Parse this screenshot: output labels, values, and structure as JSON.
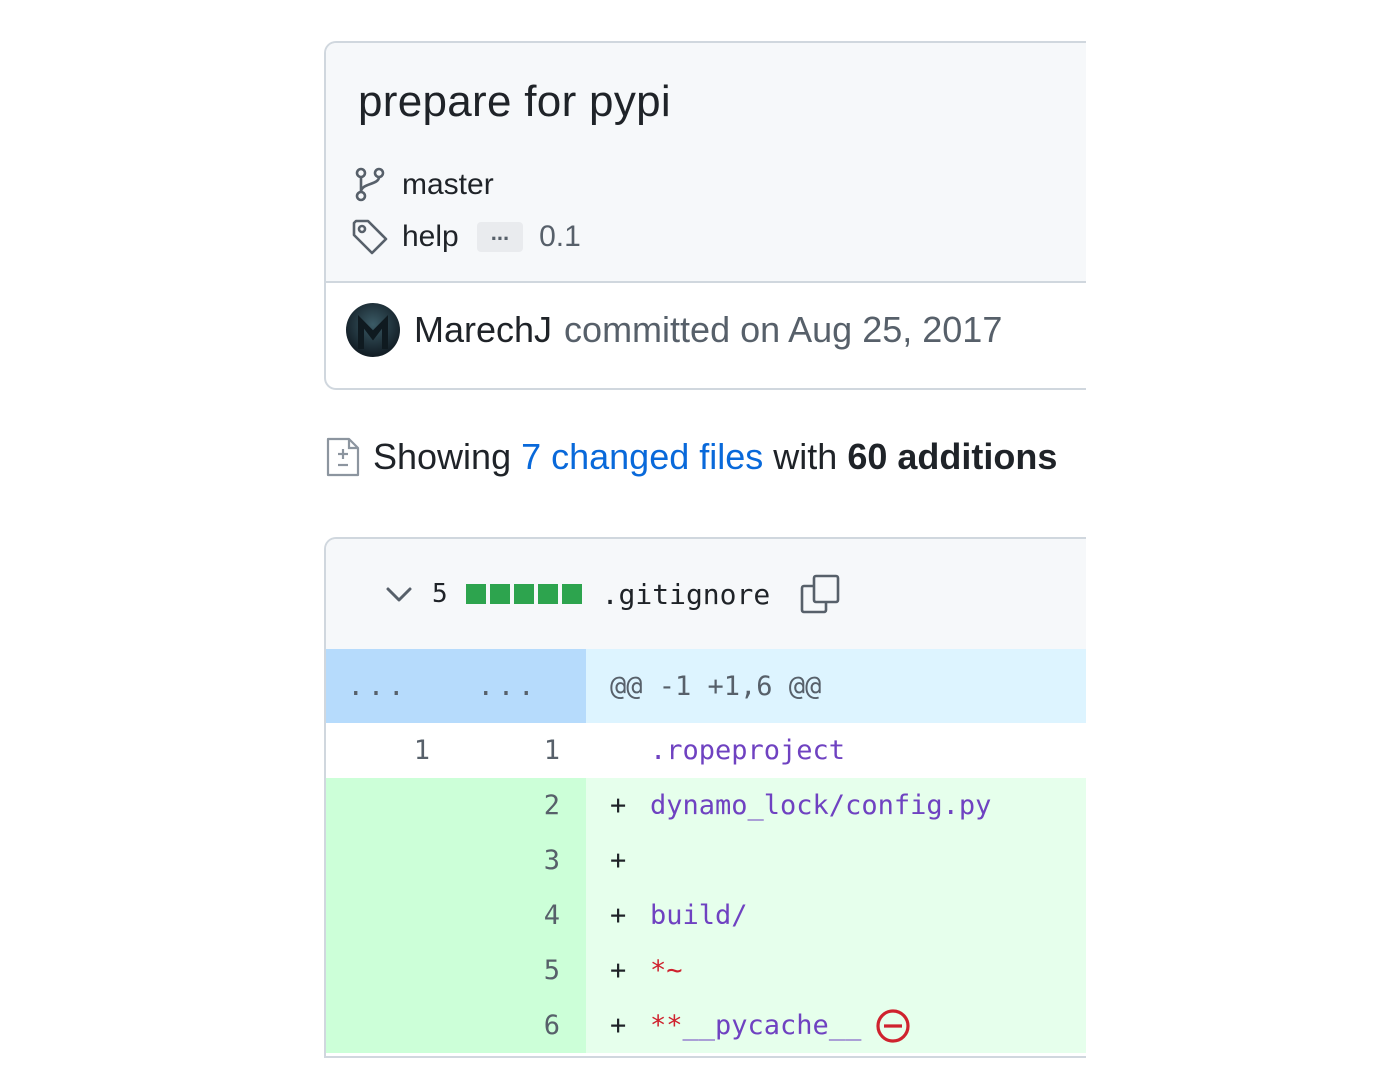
{
  "commit": {
    "title": "prepare for pypi",
    "branch": "master",
    "tag_first": "help",
    "tag_ellipsis": "...",
    "tag_last": "0.1",
    "author": "MarechJ",
    "committed_text": "committed on Aug 25, 2017"
  },
  "summary": {
    "prefix": "Showing",
    "changed_files": "7 changed files",
    "middle": "with",
    "additions": "60 additions"
  },
  "file": {
    "change_count": "5",
    "name": ".gitignore",
    "hunk_left": "...",
    "hunk_right": "...",
    "hunk_header": "@@ -1 +1,6 @@",
    "lines": [
      {
        "old": "1",
        "new": "1",
        "marker": " ",
        "text": ".ropeproject"
      },
      {
        "old": "",
        "new": "2",
        "marker": "+",
        "text": "dynamo_lock/config.py"
      },
      {
        "old": "",
        "new": "3",
        "marker": "+",
        "text": ""
      },
      {
        "old": "",
        "new": "4",
        "marker": "+",
        "text": "build/"
      },
      {
        "old": "",
        "new": "5",
        "marker": "+",
        "text": "*~"
      },
      {
        "old": "",
        "new": "6",
        "marker": "+",
        "text_red": "**",
        "text": "__pycache__"
      }
    ]
  },
  "colors": {
    "diffstat_green": "#2da44e",
    "link_blue": "#0969da",
    "no_newline_red": "#cf222e"
  },
  "icons": [
    "git-branch-icon",
    "tag-icon",
    "file-diff-icon",
    "chevron-down-icon",
    "copy-icon",
    "no-newline-icon"
  ]
}
